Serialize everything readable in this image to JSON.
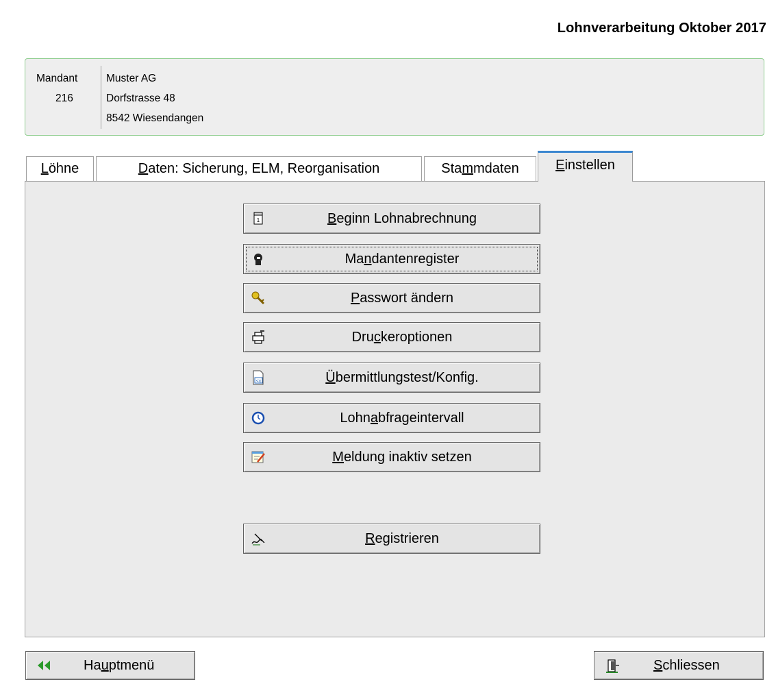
{
  "header": {
    "title": "Lohnverarbeitung Oktober 2017"
  },
  "mandant": {
    "label": "Mandant",
    "number": "216",
    "company": "Muster AG",
    "street": "Dorfstrasse 48",
    "city": "8542 Wiesendangen"
  },
  "tabs": [
    {
      "pre": "",
      "acc": "L",
      "post": "öhne"
    },
    {
      "pre": "",
      "acc": "D",
      "post": "aten: Sicherung, ELM, Reorganisation"
    },
    {
      "pre": "Sta",
      "acc": "m",
      "post": "mdaten"
    },
    {
      "pre": "",
      "acc": "E",
      "post": "instellen"
    }
  ],
  "active_tab": "Einstellen",
  "buttons": [
    {
      "pre": "",
      "acc": "B",
      "post": "eginn Lohnabrechnung",
      "icon": "calendar-icon"
    },
    {
      "pre": "Ma",
      "acc": "n",
      "post": "dantenregister",
      "icon": "person-icon"
    },
    {
      "pre": "",
      "acc": "P",
      "post": "asswort ändern",
      "icon": "key-icon"
    },
    {
      "pre": "Dru",
      "acc": "c",
      "post": "keroptionen",
      "icon": "printer-icon"
    },
    {
      "pre": "",
      "acc": "Ü",
      "post": "bermittlungstest/Konfig.",
      "icon": "xml-file-icon"
    },
    {
      "pre": "Lohn",
      "acc": "a",
      "post": "bfrageintervall",
      "icon": "clock-icon"
    },
    {
      "pre": "",
      "acc": "M",
      "post": "eldung inaktiv setzen",
      "icon": "edit-note-icon"
    },
    {
      "pre": "",
      "acc": "R",
      "post": "egistrieren",
      "icon": "signature-icon"
    }
  ],
  "footer": {
    "main_menu": {
      "pre": "Ha",
      "acc": "u",
      "post": "ptmenü"
    },
    "close": {
      "pre": "",
      "acc": "S",
      "post": "chliessen"
    }
  },
  "colors": {
    "active_tab_accent": "#3a86d0",
    "mandant_border": "#8fce8f",
    "panel_bg": "#ebebeb"
  }
}
